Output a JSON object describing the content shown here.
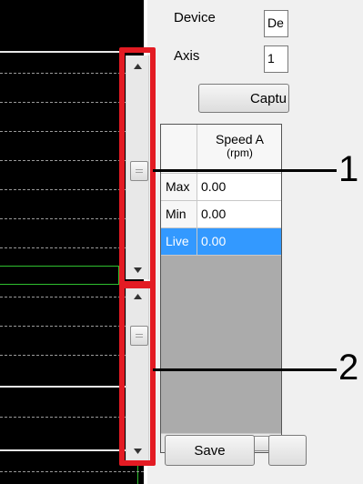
{
  "settings": {
    "device_label": "Device",
    "device_value": "De",
    "axis_label": "Axis",
    "axis_value": "1",
    "capture_button": "Captu"
  },
  "grid": {
    "column_header_line1": "Speed A",
    "column_header_line2": "(rpm)",
    "rows": [
      {
        "label": "Max",
        "value": "0.00"
      },
      {
        "label": "Min",
        "value": "0.00"
      },
      {
        "label": "Live",
        "value": "0.00"
      }
    ]
  },
  "footer": {
    "save_button": "Save"
  },
  "callouts": {
    "upper": "1",
    "lower": "2"
  },
  "colors": {
    "annotation_red": "#e31b23",
    "selection_blue": "#3399ff",
    "trace_green": "#2fbf2f"
  },
  "icons": [
    "scroll-up-arrow-icon",
    "scroll-down-arrow-icon",
    "scroll-left-arrow-icon"
  ]
}
